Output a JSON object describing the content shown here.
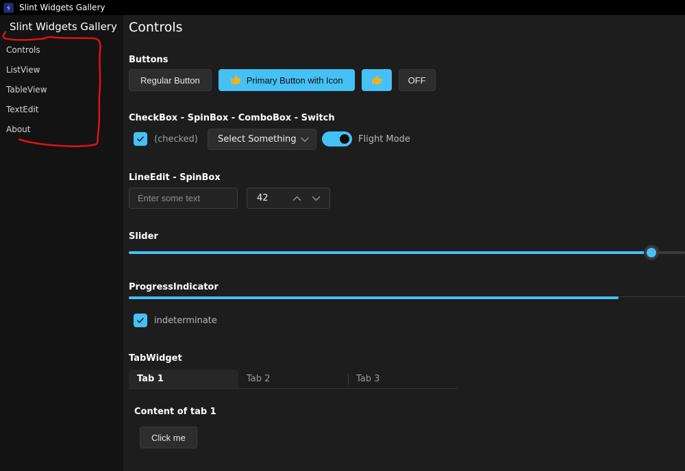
{
  "colors": {
    "accent": "#45c1f5",
    "titlebar_bg": "#000000",
    "sidebar_bg": "#131313",
    "main_bg": "#1d1d1d",
    "button_bg": "#2d2d2d",
    "annotation_red": "#d91414"
  },
  "titlebar": {
    "title": "Slint Widgets Gallery",
    "icon": "slint-logo-icon"
  },
  "sidebar": {
    "title": "Slint Widgets Gallery",
    "items": [
      {
        "label": "Controls"
      },
      {
        "label": "ListView"
      },
      {
        "label": "TableView"
      },
      {
        "label": "TextEdit"
      },
      {
        "label": "About"
      }
    ]
  },
  "main": {
    "heading": "Controls",
    "buttons_section": {
      "title": "Buttons",
      "regular_label": "Regular Button",
      "primary_label": "Primary Button with Icon",
      "primary_icon": "thumbs-up-icon",
      "thumb_icon": "thumbs-up-icon",
      "off_label": "OFF"
    },
    "widgets_section": {
      "title": "CheckBox - SpinBox - ComboBox - Switch",
      "checkbox_label": "(checked)",
      "checkbox_checked": true,
      "combobox_value": "Select Something",
      "switch_label": "Flight Mode",
      "switch_on": true
    },
    "lineedit_section": {
      "title": "LineEdit - SpinBox",
      "placeholder": "Enter some text",
      "spinbox_value": "42"
    },
    "slider_section": {
      "title": "Slider",
      "value_percent": 94
    },
    "progress_section": {
      "title": "ProgressIndicator",
      "value_percent": 88,
      "checkbox_label": "indeterminate",
      "checkbox_checked": true
    },
    "tab_section": {
      "title": "TabWidget",
      "tabs": [
        {
          "label": "Tab 1",
          "active": true
        },
        {
          "label": "Tab 2",
          "active": false
        },
        {
          "label": "Tab 3",
          "active": false
        }
      ],
      "content_title": "Content of tab 1",
      "button_label": "Click me"
    }
  },
  "annotation": {
    "description": "hand-drawn red marker stroke circling the sidebar navigation items"
  }
}
